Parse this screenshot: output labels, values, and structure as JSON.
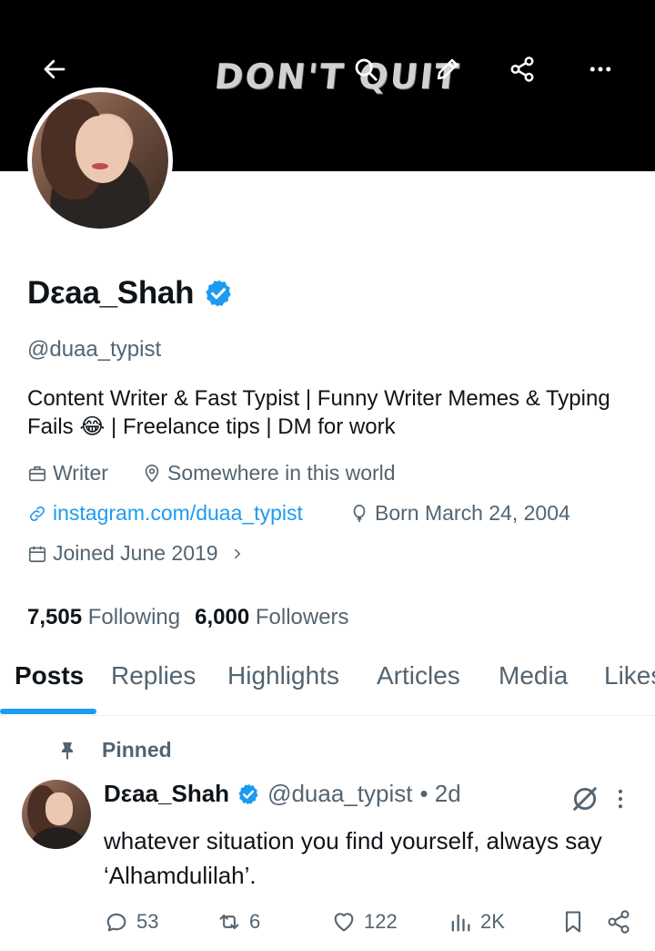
{
  "banner": {
    "art_text": "DON'T QUIT"
  },
  "header": {
    "back_icon": "arrow-left-icon",
    "search_icon": "search-icon",
    "share_icon": "share-icon",
    "more_icon": "more-horizontal-icon"
  },
  "profile": {
    "name": "Dεaa_Shah",
    "verified": true,
    "handle": "@duaa_typist",
    "bio": "Content Writer & Fast Typist | Funny Writer Memes & Typing Fails 😂 | Freelance tips | DM for work",
    "profession": "Writer",
    "location": "Somewhere in this world",
    "website": "instagram.com/duaa_typist",
    "birthday": "Born March 24, 2004",
    "joined": "Joined June 2019",
    "following_count": "7,505",
    "following_label": "Following",
    "followers_count": "6,000",
    "followers_label": "Followers"
  },
  "tabs": [
    {
      "label": "Posts",
      "active": true
    },
    {
      "label": "Replies",
      "active": false
    },
    {
      "label": "Highlights",
      "active": false
    },
    {
      "label": "Articles",
      "active": false
    },
    {
      "label": "Media",
      "active": false
    },
    {
      "label": "Likes",
      "active": false
    }
  ],
  "pinned_post": {
    "pinned_label": "Pinned",
    "author_name": "Dεaa_Shah",
    "author_handle": "@duaa_typist",
    "time": "• 2d",
    "text": "whatever situation you find yourself, always say ‘Alhamdulilah’.",
    "replies": "53",
    "reposts": "6",
    "likes": "122",
    "views": "2K"
  },
  "colors": {
    "accent": "#1d9bf0",
    "text_primary": "#0f1419",
    "text_secondary": "#536471",
    "banner": "#000000"
  }
}
